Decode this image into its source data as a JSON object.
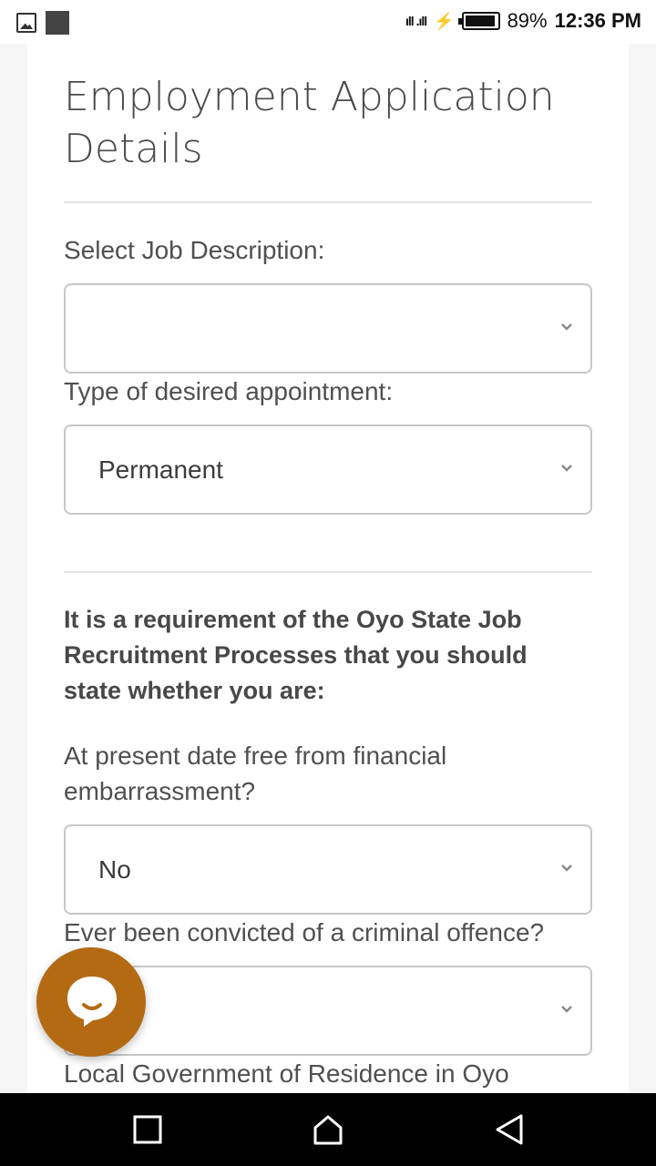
{
  "status_bar": {
    "battery_percent": "89%",
    "time": "12:36 PM",
    "signal_text": "ıll .ıll"
  },
  "page": {
    "title_line1": "Employment Application",
    "title_line2": "Details"
  },
  "form": {
    "job_description": {
      "label": "Select Job Description:",
      "value": ""
    },
    "appointment_type": {
      "label": "Type of desired appointment:",
      "value": "Permanent"
    },
    "requirement_note_line1": "It is a requirement of the Oyo State Job",
    "requirement_note_line2": "Recruitment Processes that you should",
    "requirement_note_line3": "state whether you are:",
    "financial": {
      "label_line1": "At present date free from financial",
      "label_line2": "embarrassment?",
      "value": "No"
    },
    "criminal": {
      "label": "Ever been convicted of a criminal offence?",
      "value": ""
    },
    "local_government": {
      "label": "Local Government of Residence in Oyo"
    }
  },
  "icons": {
    "chat": "chat-bubble-icon",
    "nav_recent": "square-icon",
    "nav_home": "home-icon",
    "nav_back": "back-triangle-icon"
  },
  "colors": {
    "chat_button": "#b46a12",
    "navbar": "#000000"
  }
}
